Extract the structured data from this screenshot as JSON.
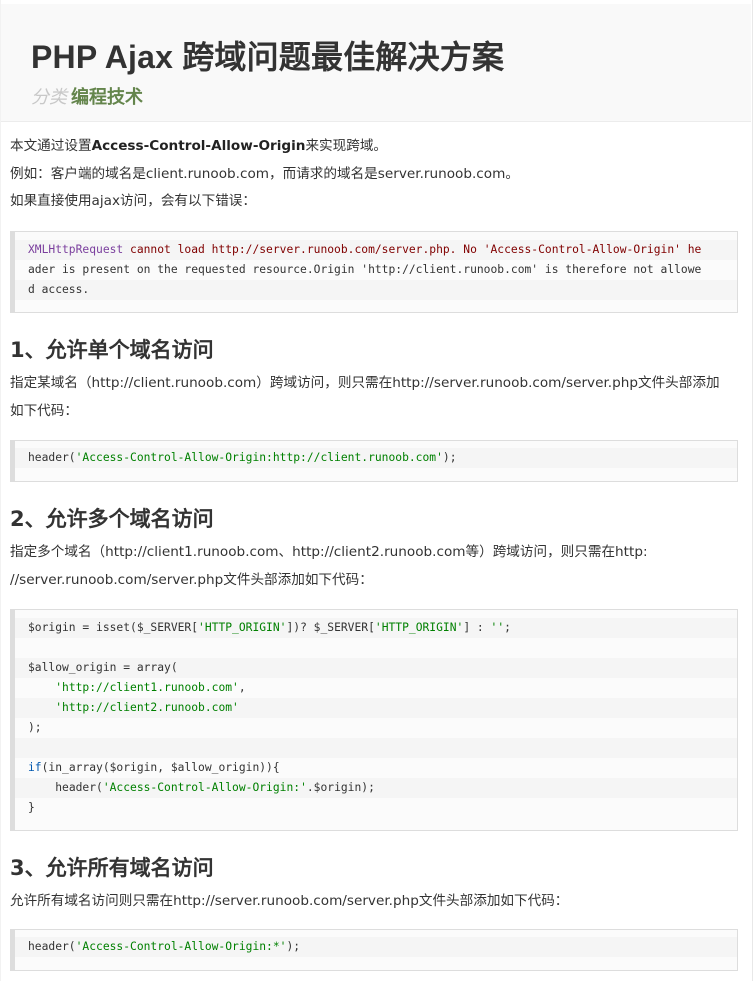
{
  "article": {
    "title": "PHP Ajax 跨域问题最佳解决方案",
    "category_label": "分类",
    "category_link": "编程技术"
  },
  "intro": {
    "line1_prefix": "本文通过设置",
    "line1_bold": "Access-Control-Allow-Origin",
    "line1_suffix": "来实现跨域。",
    "line2": "例如：客户端的域名是client.runoob.com，而请求的域名是server.runoob.com。",
    "line3": "如果直接使用ajax访问，会有以下错误："
  },
  "error_block": {
    "type": "XMLHttpRequest",
    "line1_rest": " cannot load http://server.runoob.com/server.php. No 'Access-Control-Allow-Origin' he",
    "line2": "ader is present on the requested resource.Origin 'http://client.runoob.com' is therefore not allowe",
    "line3": "d access."
  },
  "section1": {
    "heading": "1、允许单个域名访问",
    "desc1": "指定某域名（http://client.runoob.com）跨域访问，则只需在http://server.runoob.com/server.php文件头部添加",
    "desc2": "如下代码：",
    "code": {
      "fn": "header(",
      "str": "'Access-Control-Allow-Origin:http://client.runoob.com'",
      "end": ");"
    }
  },
  "section2": {
    "heading": "2、允许多个域名访问",
    "desc1": "指定多个域名（http://client1.runoob.com、http://client2.runoob.com等）跨域访问，则只需在http:",
    "desc2": "//server.runoob.com/server.php文件头部添加如下代码：",
    "code": {
      "l1a": "$origin = isset($_SERVER[",
      "l1b": "'HTTP_ORIGIN'",
      "l1c": "])? $_SERVER[",
      "l1d": "'HTTP_ORIGIN'",
      "l1e": "] : ",
      "l1f": "''",
      "l1g": ";",
      "l3": "$allow_origin = array(",
      "l4": "'http://client1.runoob.com'",
      "l4end": ",",
      "l5": "'http://client2.runoob.com'",
      "l6": ");",
      "l8kw": "if",
      "l8rest": "(in_array($origin, $allow_origin)){",
      "l9a": "header(",
      "l9b": "'Access-Control-Allow-Origin:'",
      "l9c": ".$origin);",
      "l10": "}"
    }
  },
  "section3": {
    "heading": "3、允许所有域名访问",
    "desc1": "允许所有域名访问则只需在http://server.runoob.com/server.php文件头部添加如下代码：",
    "code": {
      "fn": "header(",
      "str": "'Access-Control-Allow-Origin:*'",
      "end": ");"
    }
  }
}
